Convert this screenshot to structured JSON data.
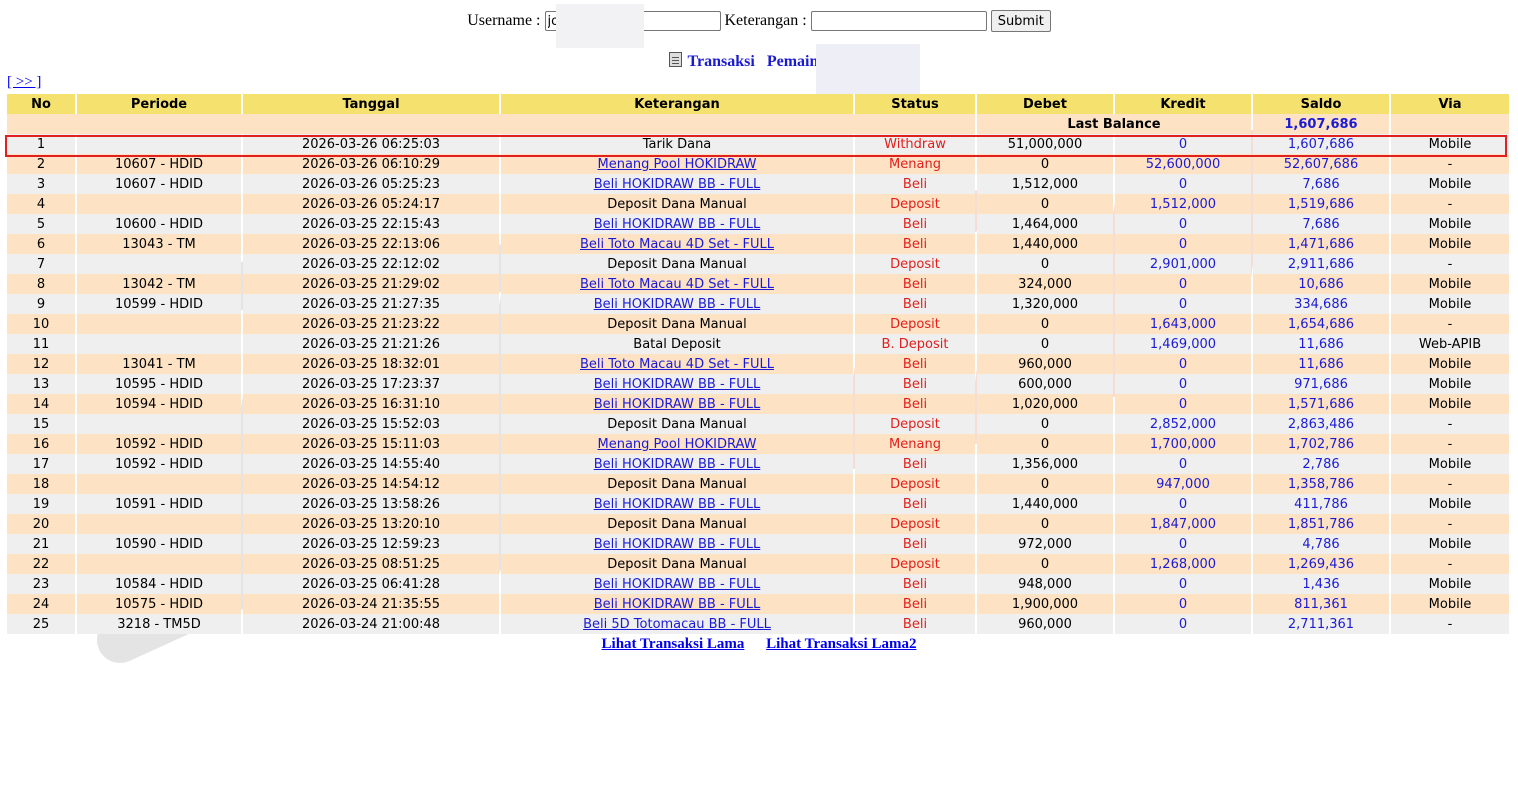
{
  "form": {
    "username_label": "Username :",
    "username_value": "jo",
    "keterangan_label": "Keterangan :",
    "keterangan_value": "",
    "submit_label": "Submit"
  },
  "title": {
    "transaksi": "Transaksi",
    "pemain": "Pemain : jol"
  },
  "nav": {
    "next": "[ >> ]"
  },
  "columns": [
    "No",
    "Periode",
    "Tanggal",
    "Keterangan",
    "Status",
    "Debet",
    "Kredit",
    "Saldo",
    "Via"
  ],
  "last_balance": {
    "label": "Last Balance",
    "value": "1,607,686"
  },
  "rows": [
    {
      "no": "1",
      "periode": "",
      "tanggal": "2026-03-26 06:25:03",
      "keterangan": "Tarik Dana",
      "link": false,
      "status": "Withdraw",
      "debet": "51,000,000",
      "kredit": "0",
      "saldo": "1,607,686",
      "via": "Mobile"
    },
    {
      "no": "2",
      "periode": "10607 - HDID",
      "tanggal": "2026-03-26 06:10:29",
      "keterangan": "Menang Pool HOKIDRAW",
      "link": true,
      "status": "Menang",
      "debet": "0",
      "kredit": "52,600,000",
      "saldo": "52,607,686",
      "via": "-"
    },
    {
      "no": "3",
      "periode": "10607 - HDID",
      "tanggal": "2026-03-26 05:25:23",
      "keterangan": "Beli HOKIDRAW BB - FULL",
      "link": true,
      "status": "Beli",
      "debet": "1,512,000",
      "kredit": "0",
      "saldo": "7,686",
      "via": "Mobile"
    },
    {
      "no": "4",
      "periode": "",
      "tanggal": "2026-03-26 05:24:17",
      "keterangan": "Deposit Dana Manual",
      "link": false,
      "status": "Deposit",
      "debet": "0",
      "kredit": "1,512,000",
      "saldo": "1,519,686",
      "via": "-"
    },
    {
      "no": "5",
      "periode": "10600 - HDID",
      "tanggal": "2026-03-25 22:15:43",
      "keterangan": "Beli HOKIDRAW BB - FULL",
      "link": true,
      "status": "Beli",
      "debet": "1,464,000",
      "kredit": "0",
      "saldo": "7,686",
      "via": "Mobile"
    },
    {
      "no": "6",
      "periode": "13043 - TM",
      "tanggal": "2026-03-25 22:13:06",
      "keterangan": "Beli Toto Macau 4D Set - FULL",
      "link": true,
      "status": "Beli",
      "debet": "1,440,000",
      "kredit": "0",
      "saldo": "1,471,686",
      "via": "Mobile"
    },
    {
      "no": "7",
      "periode": "",
      "tanggal": "2026-03-25 22:12:02",
      "keterangan": "Deposit Dana Manual",
      "link": false,
      "status": "Deposit",
      "debet": "0",
      "kredit": "2,901,000",
      "saldo": "2,911,686",
      "via": "-"
    },
    {
      "no": "8",
      "periode": "13042 - TM",
      "tanggal": "2026-03-25 21:29:02",
      "keterangan": "Beli Toto Macau 4D Set - FULL",
      "link": true,
      "status": "Beli",
      "debet": "324,000",
      "kredit": "0",
      "saldo": "10,686",
      "via": "Mobile"
    },
    {
      "no": "9",
      "periode": "10599 - HDID",
      "tanggal": "2026-03-25 21:27:35",
      "keterangan": "Beli HOKIDRAW BB - FULL",
      "link": true,
      "status": "Beli",
      "debet": "1,320,000",
      "kredit": "0",
      "saldo": "334,686",
      "via": "Mobile"
    },
    {
      "no": "10",
      "periode": "",
      "tanggal": "2026-03-25 21:23:22",
      "keterangan": "Deposit Dana Manual",
      "link": false,
      "status": "Deposit",
      "debet": "0",
      "kredit": "1,643,000",
      "saldo": "1,654,686",
      "via": "-"
    },
    {
      "no": "11",
      "periode": "",
      "tanggal": "2026-03-25 21:21:26",
      "keterangan": "Batal Deposit",
      "link": false,
      "status": "B. Deposit",
      "debet": "0",
      "kredit": "1,469,000",
      "saldo": "11,686",
      "via": "Web-APIB"
    },
    {
      "no": "12",
      "periode": "13041 - TM",
      "tanggal": "2026-03-25 18:32:01",
      "keterangan": "Beli Toto Macau 4D Set - FULL",
      "link": true,
      "status": "Beli",
      "debet": "960,000",
      "kredit": "0",
      "saldo": "11,686",
      "via": "Mobile"
    },
    {
      "no": "13",
      "periode": "10595 - HDID",
      "tanggal": "2026-03-25 17:23:37",
      "keterangan": "Beli HOKIDRAW BB - FULL",
      "link": true,
      "status": "Beli",
      "debet": "600,000",
      "kredit": "0",
      "saldo": "971,686",
      "via": "Mobile"
    },
    {
      "no": "14",
      "periode": "10594 - HDID",
      "tanggal": "2026-03-25 16:31:10",
      "keterangan": "Beli HOKIDRAW BB - FULL",
      "link": true,
      "status": "Beli",
      "debet": "1,020,000",
      "kredit": "0",
      "saldo": "1,571,686",
      "via": "Mobile"
    },
    {
      "no": "15",
      "periode": "",
      "tanggal": "2026-03-25 15:52:03",
      "keterangan": "Deposit Dana Manual",
      "link": false,
      "status": "Deposit",
      "debet": "0",
      "kredit": "2,852,000",
      "saldo": "2,863,486",
      "via": "-"
    },
    {
      "no": "16",
      "periode": "10592 - HDID",
      "tanggal": "2026-03-25 15:11:03",
      "keterangan": "Menang Pool HOKIDRAW",
      "link": true,
      "status": "Menang",
      "debet": "0",
      "kredit": "1,700,000",
      "saldo": "1,702,786",
      "via": "-"
    },
    {
      "no": "17",
      "periode": "10592 - HDID",
      "tanggal": "2026-03-25 14:55:40",
      "keterangan": "Beli HOKIDRAW BB - FULL",
      "link": true,
      "status": "Beli",
      "debet": "1,356,000",
      "kredit": "0",
      "saldo": "2,786",
      "via": "Mobile"
    },
    {
      "no": "18",
      "periode": "",
      "tanggal": "2026-03-25 14:54:12",
      "keterangan": "Deposit Dana Manual",
      "link": false,
      "status": "Deposit",
      "debet": "0",
      "kredit": "947,000",
      "saldo": "1,358,786",
      "via": "-"
    },
    {
      "no": "19",
      "periode": "10591 - HDID",
      "tanggal": "2026-03-25 13:58:26",
      "keterangan": "Beli HOKIDRAW BB - FULL",
      "link": true,
      "status": "Beli",
      "debet": "1,440,000",
      "kredit": "0",
      "saldo": "411,786",
      "via": "Mobile"
    },
    {
      "no": "20",
      "periode": "",
      "tanggal": "2026-03-25 13:20:10",
      "keterangan": "Deposit Dana Manual",
      "link": false,
      "status": "Deposit",
      "debet": "0",
      "kredit": "1,847,000",
      "saldo": "1,851,786",
      "via": "-"
    },
    {
      "no": "21",
      "periode": "10590 - HDID",
      "tanggal": "2026-03-25 12:59:23",
      "keterangan": "Beli HOKIDRAW BB - FULL",
      "link": true,
      "status": "Beli",
      "debet": "972,000",
      "kredit": "0",
      "saldo": "4,786",
      "via": "Mobile"
    },
    {
      "no": "22",
      "periode": "",
      "tanggal": "2026-03-25 08:51:25",
      "keterangan": "Deposit Dana Manual",
      "link": false,
      "status": "Deposit",
      "debet": "0",
      "kredit": "1,268,000",
      "saldo": "1,269,436",
      "via": "-"
    },
    {
      "no": "23",
      "periode": "10584 - HDID",
      "tanggal": "2026-03-25 06:41:28",
      "keterangan": "Beli HOKIDRAW BB - FULL",
      "link": true,
      "status": "Beli",
      "debet": "948,000",
      "kredit": "0",
      "saldo": "1,436",
      "via": "Mobile"
    },
    {
      "no": "24",
      "periode": "10575 - HDID",
      "tanggal": "2026-03-24 21:35:55",
      "keterangan": "Beli HOKIDRAW BB - FULL",
      "link": true,
      "status": "Beli",
      "debet": "1,900,000",
      "kredit": "0",
      "saldo": "811,361",
      "via": "Mobile"
    },
    {
      "no": "25",
      "periode": "3218 - TM5D",
      "tanggal": "2026-03-24 21:00:48",
      "keterangan": "Beli 5D Totomacau BB - FULL",
      "link": true,
      "status": "Beli",
      "debet": "960,000",
      "kredit": "0",
      "saldo": "2,711,361",
      "via": "-"
    }
  ],
  "footer": {
    "old_link": "Lihat Transaksi Lama",
    "old_link2": "Lihat Transaksi Lama2"
  },
  "colors": {
    "header_bg": "#f5e26e",
    "row_odd": "#efefef",
    "row_even": "#fde2c4",
    "status_red": "#e0201d",
    "value_blue": "#1b1bd6",
    "highlight": "#e12020"
  }
}
